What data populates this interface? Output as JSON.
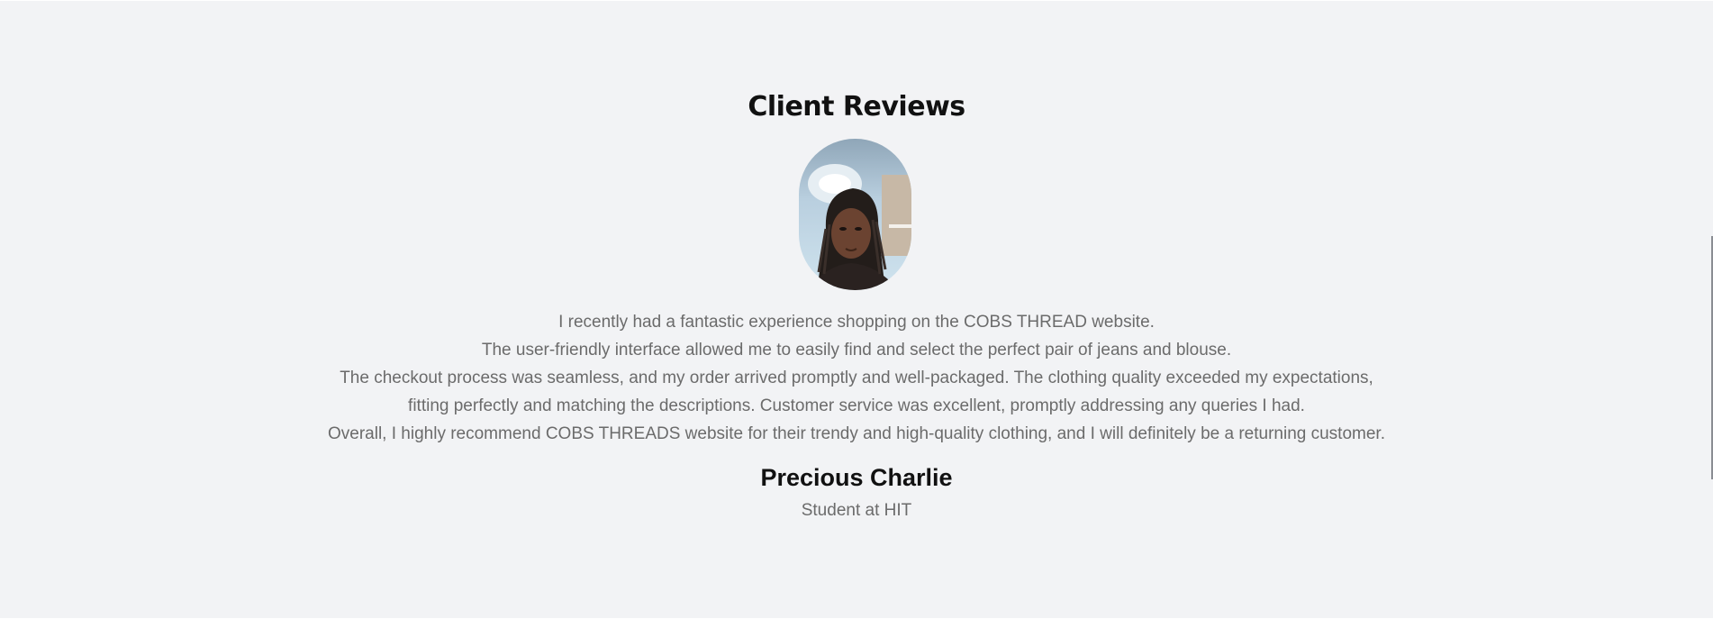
{
  "section": {
    "title": "Client Reviews"
  },
  "review": {
    "lines": [
      "I recently had a fantastic experience shopping on the COBS THREAD website.",
      "The user-friendly interface allowed me to easily find and select the perfect pair of jeans and blouse.",
      "The checkout process was seamless, and my order arrived promptly and well-packaged. The clothing quality exceeded my expectations,",
      "fitting perfectly and matching the descriptions. Customer service was excellent, promptly addressing any queries I had.",
      "Overall, I highly recommend COBS THREADS website for their trendy and high-quality clothing, and I will definitely be a returning customer."
    ],
    "author": "Precious Charlie",
    "role": "Student at HIT"
  },
  "colors": {
    "background": "#f2f3f5",
    "title": "#111111",
    "body_text": "#6b6b6b"
  }
}
